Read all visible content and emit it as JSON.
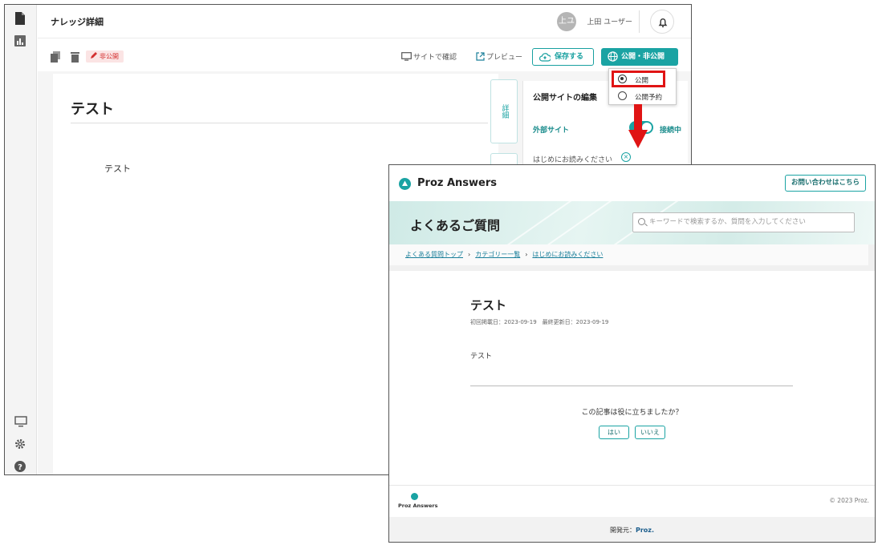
{
  "admin": {
    "page_title": "ナレッジ詳細",
    "user": {
      "avatar_text": "上ユ",
      "name": "上田 ユーザー"
    },
    "toolbar": {
      "status_badge": "非公開",
      "site_check": "サイトで確認",
      "preview": "プレビュー",
      "save": "保存する",
      "publish": "公開・非公開"
    },
    "document": {
      "title": "テスト",
      "body": "テスト"
    },
    "side_tabs": [
      "詳細"
    ],
    "panel": {
      "heading": "公開サイトの編集",
      "external_site_label": "外部サイト",
      "connection_status": "接続中",
      "category": "はじめにお読みください"
    },
    "publish_menu": {
      "options": [
        "公開",
        "公開予約"
      ],
      "selected": "公開"
    },
    "colors": {
      "accent": "#1aa3a3",
      "danger": "#e01414"
    }
  },
  "site": {
    "brand": "Proz Answers",
    "contact_button": "お問い合わせはこちら",
    "faq_title": "よくあるご質問",
    "search_placeholder": "キーワードで検索するか、質問を入力してください",
    "breadcrumb": [
      "よくある質問トップ",
      "カテゴリー一覧",
      "はじめにお読みください"
    ],
    "article": {
      "title": "テスト",
      "dates": "初回掲載日：2023-09-19　最終更新日：2023-09-19",
      "body": "テスト"
    },
    "feedback": {
      "question": "この記事は役に立ちましたか？",
      "yes": "はい",
      "no": "いいえ"
    },
    "footer": {
      "brand": "Proz Answers",
      "copyright": "© 2023 Proz.",
      "developer_label": "開発元：",
      "developer": "Proz."
    }
  }
}
